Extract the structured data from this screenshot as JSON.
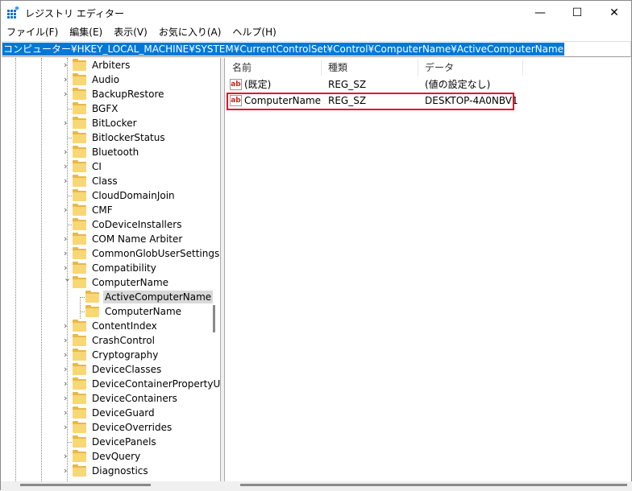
{
  "window": {
    "title": "レジストリ エディター",
    "controls": {
      "minimize": "—",
      "maximize": "☐",
      "close": "✕"
    }
  },
  "menu": [
    "ファイル(F)",
    "編集(E)",
    "表示(V)",
    "お気に入り(A)",
    "ヘルプ(H)"
  ],
  "address": "コンピューター¥HKEY_LOCAL_MACHINE¥SYSTEM¥CurrentControlSet¥Control¥ComputerName¥ActiveComputerName",
  "tree": [
    {
      "label": "Arbiters",
      "chevron": "›",
      "level": 0
    },
    {
      "label": "Audio",
      "chevron": "›",
      "level": 0
    },
    {
      "label": "BackupRestore",
      "chevron": "›",
      "level": 0
    },
    {
      "label": "BGFX",
      "chevron": "",
      "level": 0
    },
    {
      "label": "BitLocker",
      "chevron": "›",
      "level": 0
    },
    {
      "label": "BitlockerStatus",
      "chevron": "",
      "level": 0
    },
    {
      "label": "Bluetooth",
      "chevron": "›",
      "level": 0
    },
    {
      "label": "CI",
      "chevron": "›",
      "level": 0
    },
    {
      "label": "Class",
      "chevron": "›",
      "level": 0
    },
    {
      "label": "CloudDomainJoin",
      "chevron": "",
      "level": 0
    },
    {
      "label": "CMF",
      "chevron": "›",
      "level": 0
    },
    {
      "label": "CoDeviceInstallers",
      "chevron": "",
      "level": 0
    },
    {
      "label": "COM Name Arbiter",
      "chevron": "›",
      "level": 0
    },
    {
      "label": "CommonGlobUserSettings",
      "chevron": "›",
      "level": 0
    },
    {
      "label": "Compatibility",
      "chevron": "›",
      "level": 0
    },
    {
      "label": "ComputerName",
      "chevron": "⌄",
      "level": 0
    },
    {
      "label": "ActiveComputerName",
      "chevron": "",
      "level": 1,
      "selected": true
    },
    {
      "label": "ComputerName",
      "chevron": "",
      "level": 1
    },
    {
      "label": "ContentIndex",
      "chevron": "›",
      "level": 0
    },
    {
      "label": "CrashControl",
      "chevron": "›",
      "level": 0
    },
    {
      "label": "Cryptography",
      "chevron": "›",
      "level": 0
    },
    {
      "label": "DeviceClasses",
      "chevron": "›",
      "level": 0
    },
    {
      "label": "DeviceContainerPropertyUp",
      "chevron": "›",
      "level": 0
    },
    {
      "label": "DeviceContainers",
      "chevron": "›",
      "level": 0
    },
    {
      "label": "DeviceGuard",
      "chevron": "›",
      "level": 0
    },
    {
      "label": "DeviceOverrides",
      "chevron": "›",
      "level": 0
    },
    {
      "label": "DevicePanels",
      "chevron": "",
      "level": 0
    },
    {
      "label": "DevQuery",
      "chevron": "›",
      "level": 0
    },
    {
      "label": "Diagnostics",
      "chevron": "›",
      "level": 0
    }
  ],
  "list": {
    "columns": [
      "名前",
      "種類",
      "データ"
    ],
    "rows": [
      {
        "name": "(既定)",
        "type": "REG_SZ",
        "data": "(値の設定なし)",
        "icon": "ab"
      },
      {
        "name": "ComputerName",
        "type": "REG_SZ",
        "data": "DESKTOP-4A0NBV1",
        "icon": "ab"
      }
    ]
  },
  "colors": {
    "selection": "#0078d7",
    "highlight_box": "#e81123"
  }
}
